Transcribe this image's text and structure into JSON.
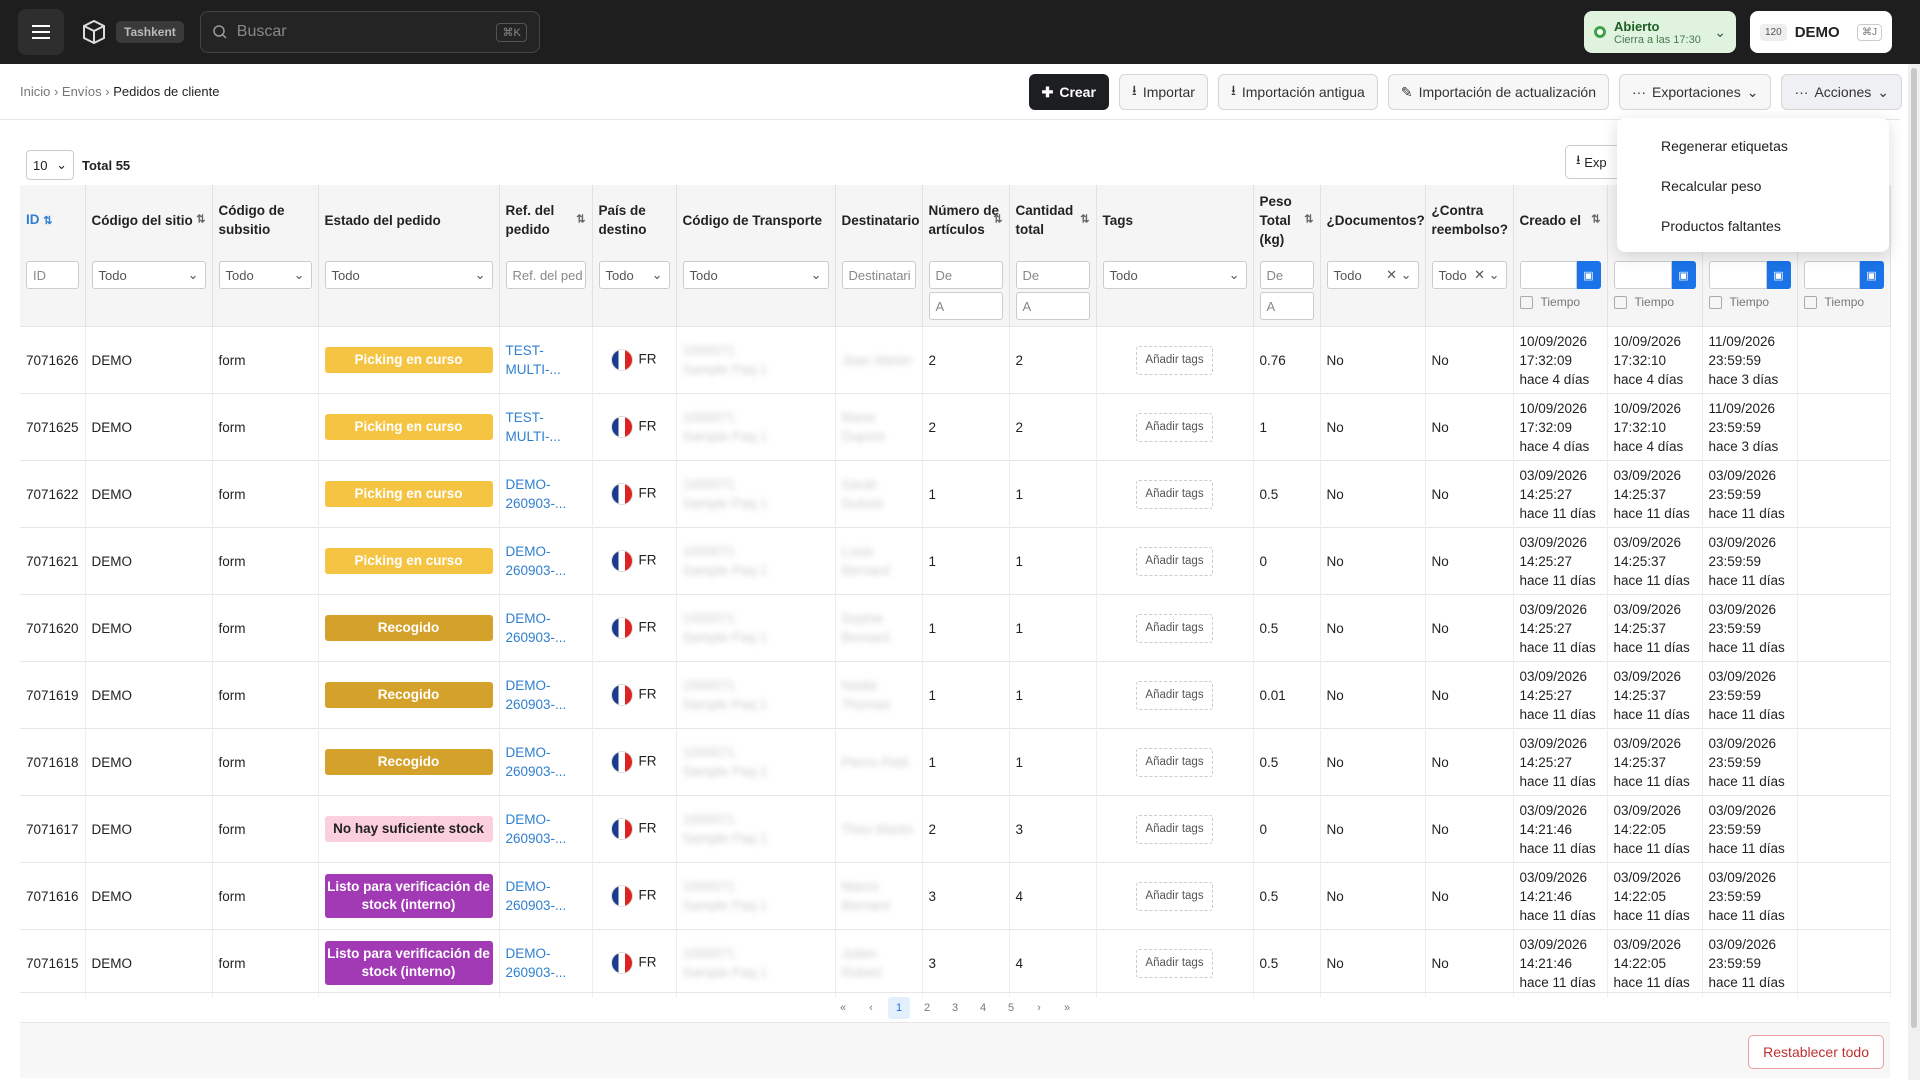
{
  "topbar": {
    "location_badge": "Tashkent",
    "search_placeholder": "Buscar",
    "search_shortcut": "⌘K",
    "status_title": "Abierto",
    "status_subtitle": "Cierra a las 17:30",
    "account_count": "120",
    "account_name": "DEMO",
    "account_shortcut": "⌘J"
  },
  "breadcrumb": {
    "home": "Inicio",
    "section": "Envíos",
    "current": "Pedidos de cliente"
  },
  "actions": {
    "create": "Crear",
    "import": "Importar",
    "import_old": "Importación antigua",
    "import_update": "Importación de actualización",
    "exports": "Exportaciones",
    "actions": "Acciones"
  },
  "dropdown": [
    "Regenerar etiquetas",
    "Recalcular peso",
    "Productos faltantes"
  ],
  "toolbar": {
    "page_size": "10",
    "total": "Total 55",
    "export_label": "Exp"
  },
  "columns": {
    "id": "ID",
    "site": "Código del sitio",
    "subsite": "Código de subsitio",
    "state": "Estado del pedido",
    "ref": "Ref. del pedido",
    "country": "País de destino",
    "carrier": "Código de Transporte",
    "recipient": "Destinatario",
    "items": "Número de artículos",
    "qty": "Cantidad total",
    "tags": "Tags",
    "weight": "Peso Total (kg)",
    "docs": "¿Documentos?",
    "cod": "¿Contra reembolso?",
    "created": "Creado el",
    "c2": "",
    "c3": "",
    "c4": ""
  },
  "filters": {
    "id": "ID",
    "todo": "Todo",
    "ref": "Ref. del ped",
    "recipient": "Destinatari",
    "from": "De",
    "to": "A",
    "time": "Tiempo"
  },
  "rows": [
    {
      "id": "7071626",
      "site": "DEMO",
      "sub": "form",
      "state": "Picking en curso",
      "cls": "b-pick",
      "ref1": "TEST-",
      "ref2": "MULTI-...",
      "country": "FR",
      "carrier1": "1000071",
      "carrier2": "Sample Paq 1",
      "rec1": "Jean Martin",
      "rec2": "",
      "items": "2",
      "qty": "2",
      "tag": "Añadir tags",
      "weight": "0.76",
      "docs": "No",
      "cod": "No",
      "d1": "10/09/2026",
      "t1": "17:32:09",
      "a1": "hace 4 días",
      "d2": "10/09/2026",
      "t2": "17:32:10",
      "a2": "hace 4 días",
      "d3": "11/09/2026",
      "t3": "23:59:59",
      "a3": "hace 3 días"
    },
    {
      "id": "7071625",
      "site": "DEMO",
      "sub": "form",
      "state": "Picking en curso",
      "cls": "b-pick",
      "ref1": "TEST-",
      "ref2": "MULTI-...",
      "country": "FR",
      "carrier1": "1000071",
      "carrier2": "Sample Paq 1",
      "rec1": "Marie",
      "rec2": "Dupont",
      "items": "2",
      "qty": "2",
      "tag": "Añadir tags",
      "weight": "1",
      "docs": "No",
      "cod": "No",
      "d1": "10/09/2026",
      "t1": "17:32:09",
      "a1": "hace 4 días",
      "d2": "10/09/2026",
      "t2": "17:32:10",
      "a2": "hace 4 días",
      "d3": "11/09/2026",
      "t3": "23:59:59",
      "a3": "hace 3 días"
    },
    {
      "id": "7071622",
      "site": "DEMO",
      "sub": "form",
      "state": "Picking en curso",
      "cls": "b-pick",
      "ref1": "DEMO-",
      "ref2": "260903-...",
      "country": "FR",
      "carrier1": "1000071",
      "carrier2": "Sample Paq 1",
      "rec1": "Sarah",
      "rec2": "Dubois",
      "items": "1",
      "qty": "1",
      "tag": "Añadir tags",
      "weight": "0.5",
      "docs": "No",
      "cod": "No",
      "d1": "03/09/2026",
      "t1": "14:25:27",
      "a1": "hace 11 días",
      "d2": "03/09/2026",
      "t2": "14:25:37",
      "a2": "hace 11 días",
      "d3": "03/09/2026",
      "t3": "23:59:59",
      "a3": "hace 11 días"
    },
    {
      "id": "7071621",
      "site": "DEMO",
      "sub": "form",
      "state": "Picking en curso",
      "cls": "b-pick",
      "ref1": "DEMO-",
      "ref2": "260903-...",
      "country": "FR",
      "carrier1": "1000071",
      "carrier2": "Sample Paq 1",
      "rec1": "Louis",
      "rec2": "Bernard",
      "items": "1",
      "qty": "1",
      "tag": "Añadir tags",
      "weight": "0",
      "docs": "No",
      "cod": "No",
      "d1": "03/09/2026",
      "t1": "14:25:27",
      "a1": "hace 11 días",
      "d2": "03/09/2026",
      "t2": "14:25:37",
      "a2": "hace 11 días",
      "d3": "03/09/2026",
      "t3": "23:59:59",
      "a3": "hace 11 días"
    },
    {
      "id": "7071620",
      "site": "DEMO",
      "sub": "form",
      "state": "Recogido",
      "cls": "b-rec",
      "ref1": "DEMO-",
      "ref2": "260903-...",
      "country": "FR",
      "carrier1": "1000071",
      "carrier2": "Sample Paq 1",
      "rec1": "Sophie",
      "rec2": "Bernard",
      "items": "1",
      "qty": "1",
      "tag": "Añadir tags",
      "weight": "0.5",
      "docs": "No",
      "cod": "No",
      "d1": "03/09/2026",
      "t1": "14:25:27",
      "a1": "hace 11 días",
      "d2": "03/09/2026",
      "t2": "14:25:37",
      "a2": "hace 11 días",
      "d3": "03/09/2026",
      "t3": "23:59:59",
      "a3": "hace 11 días"
    },
    {
      "id": "7071619",
      "site": "DEMO",
      "sub": "form",
      "state": "Recogido",
      "cls": "b-rec",
      "ref1": "DEMO-",
      "ref2": "260903-...",
      "country": "FR",
      "carrier1": "1000071",
      "carrier2": "Sample Paq 1",
      "rec1": "Nadia",
      "rec2": "Thomas",
      "items": "1",
      "qty": "1",
      "tag": "Añadir tags",
      "weight": "0.01",
      "docs": "No",
      "cod": "No",
      "d1": "03/09/2026",
      "t1": "14:25:27",
      "a1": "hace 11 días",
      "d2": "03/09/2026",
      "t2": "14:25:37",
      "a2": "hace 11 días",
      "d3": "03/09/2026",
      "t3": "23:59:59",
      "a3": "hace 11 días"
    },
    {
      "id": "7071618",
      "site": "DEMO",
      "sub": "form",
      "state": "Recogido",
      "cls": "b-rec",
      "ref1": "DEMO-",
      "ref2": "260903-...",
      "country": "FR",
      "carrier1": "1000071",
      "carrier2": "Sample Paq 1",
      "rec1": "Pierre Petit",
      "rec2": "",
      "items": "1",
      "qty": "1",
      "tag": "Añadir tags",
      "weight": "0.5",
      "docs": "No",
      "cod": "No",
      "d1": "03/09/2026",
      "t1": "14:25:27",
      "a1": "hace 11 días",
      "d2": "03/09/2026",
      "t2": "14:25:37",
      "a2": "hace 11 días",
      "d3": "03/09/2026",
      "t3": "23:59:59",
      "a3": "hace 11 días"
    },
    {
      "id": "7071617",
      "site": "DEMO",
      "sub": "form",
      "state": "No hay suficiente stock",
      "cls": "b-nostock",
      "ref1": "DEMO-",
      "ref2": "260903-...",
      "country": "FR",
      "carrier1": "1000071",
      "carrier2": "Sample Paq 1",
      "rec1": "Theo Martin",
      "rec2": "",
      "items": "2",
      "qty": "3",
      "tag": "Añadir tags",
      "weight": "0",
      "docs": "No",
      "cod": "No",
      "d1": "03/09/2026",
      "t1": "14:21:46",
      "a1": "hace 11 días",
      "d2": "03/09/2026",
      "t2": "14:22:05",
      "a2": "hace 11 días",
      "d3": "03/09/2026",
      "t3": "23:59:59",
      "a3": "hace 11 días"
    },
    {
      "id": "7071616",
      "site": "DEMO",
      "sub": "form",
      "state": "Listo para verificación de stock (interno)",
      "cls": "b-listo",
      "ref1": "DEMO-",
      "ref2": "260903-...",
      "country": "FR",
      "carrier1": "1000071",
      "carrier2": "Sample Paq 1",
      "rec1": "Marco",
      "rec2": "Bernard",
      "items": "3",
      "qty": "4",
      "tag": "Añadir tags",
      "weight": "0.5",
      "docs": "No",
      "cod": "No",
      "d1": "03/09/2026",
      "t1": "14:21:46",
      "a1": "hace 11 días",
      "d2": "03/09/2026",
      "t2": "14:22:05",
      "a2": "hace 11 días",
      "d3": "03/09/2026",
      "t3": "23:59:59",
      "a3": "hace 11 días"
    },
    {
      "id": "7071615",
      "site": "DEMO",
      "sub": "form",
      "state": "Listo para verificación de stock (interno)",
      "cls": "b-listo",
      "ref1": "DEMO-",
      "ref2": "260903-...",
      "country": "FR",
      "carrier1": "1000071",
      "carrier2": "Sample Paq 1",
      "rec1": "Julien",
      "rec2": "Robert",
      "items": "3",
      "qty": "4",
      "tag": "Añadir tags",
      "weight": "0.5",
      "docs": "No",
      "cod": "No",
      "d1": "03/09/2026",
      "t1": "14:21:46",
      "a1": "hace 11 días",
      "d2": "03/09/2026",
      "t2": "14:22:05",
      "a2": "hace 11 días",
      "d3": "03/09/2026",
      "t3": "23:59:59",
      "a3": "hace 11 días"
    }
  ],
  "pagination": {
    "first": "«",
    "prev": "‹",
    "pages": [
      "1",
      "2",
      "3",
      "4",
      "5"
    ],
    "next": "›",
    "last": "»"
  },
  "footer": {
    "reset": "Restablecer todo"
  }
}
